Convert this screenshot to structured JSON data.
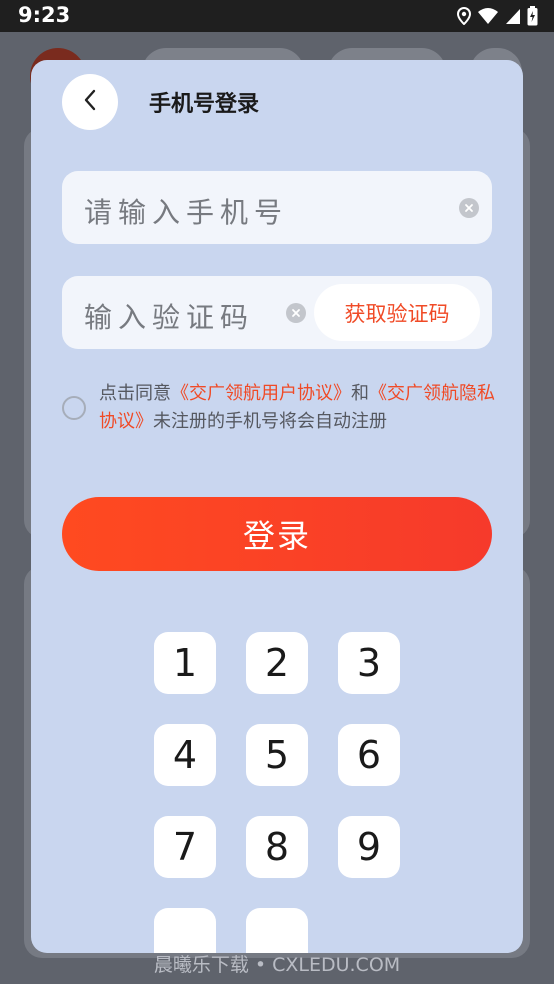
{
  "status_bar": {
    "time": "9:23",
    "icons": [
      "location-icon",
      "wifi-icon",
      "signal-icon",
      "battery-icon"
    ]
  },
  "header": {
    "title": "手机号登录",
    "back_icon": "chevron-left-icon"
  },
  "phone_field": {
    "placeholder": "请输入手机号",
    "clear_icon": "clear-circle-icon"
  },
  "code_field": {
    "placeholder": "输入验证码",
    "clear_icon": "clear-circle-icon",
    "get_code_label": "获取验证码"
  },
  "agreement": {
    "prefix": "点击同意",
    "user_agreement": "《交广领航用户协议》",
    "and": "和",
    "privacy_policy": "《交广领航隐私协议》",
    "suffix": "未注册的手机号将会自动注册",
    "checked": false
  },
  "login_button": {
    "label": "登录"
  },
  "keypad": {
    "keys": [
      "1",
      "2",
      "3",
      "4",
      "5",
      "6",
      "7",
      "8",
      "9"
    ]
  },
  "watermark": "晨曦乐下载 • CXLEDU.COM",
  "colors": {
    "accent": "#f04a26",
    "sheet_bg": "#c9d6ef",
    "button_gradient_start": "#ff4a20",
    "button_gradient_end": "#f63a2b"
  }
}
